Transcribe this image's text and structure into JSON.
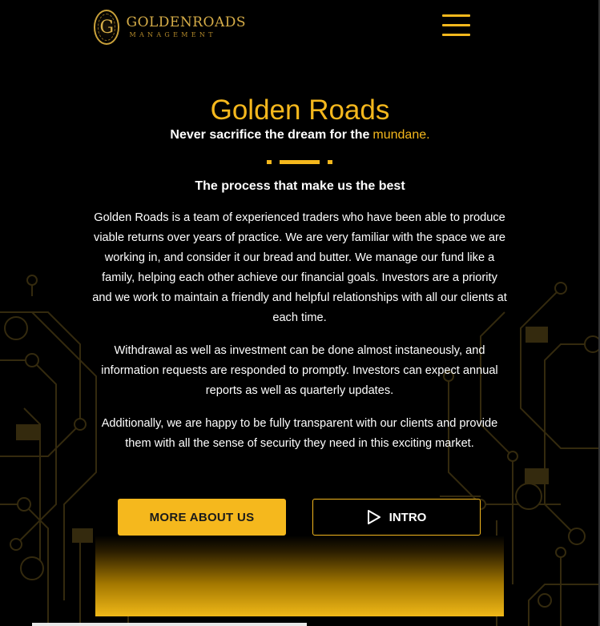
{
  "brand": {
    "logo_letter": "G",
    "name": "GOLDENROADS",
    "sub": "MANAGEMENT"
  },
  "header": {
    "menu_icon": "hamburger-menu-icon"
  },
  "hero": {
    "title": "Golden Roads",
    "tagline_bold": "Never sacrifice the dream for the",
    "tagline_accent": "mundane."
  },
  "section": {
    "heading": "The process that make us the best",
    "paragraphs": [
      "Golden Roads is a team of experienced traders who have been able to produce viable returns over years of practice. We are very familiar with the space we are working in, and consider it our bread and butter. We manage our fund like a family, helping each other achieve our financial goals. Investors are a priority and we work to maintain a friendly and helpful relationships with all our clients at each time.",
      "Withdrawal as well as investment can be done almost instaneously, and information requests are responded to promptly. Investors can expect annual reports as well as quarterly updates.",
      "Additionally, we are happy to be fully transparent with our clients and provide them with all the sense of security they need in this exciting market."
    ]
  },
  "buttons": {
    "more_about_us": "MORE ABOUT US",
    "intro": "INTRO",
    "intro_icon": "play-icon"
  },
  "colors": {
    "accent": "#f5b81d",
    "background": "#000000",
    "text": "#ffffff"
  }
}
